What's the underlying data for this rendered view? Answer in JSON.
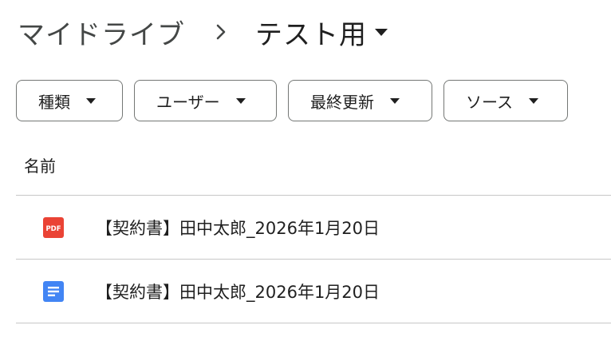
{
  "breadcrumb": {
    "root": "マイドライブ",
    "separator_icon": "chevron-right-icon",
    "current": "テスト用",
    "current_caret_icon": "caret-down-icon"
  },
  "filters": [
    {
      "label": "種類",
      "icon": "caret-down-icon"
    },
    {
      "label": "ユーザー",
      "icon": "caret-down-icon"
    },
    {
      "label": "最終更新",
      "icon": "caret-down-icon"
    },
    {
      "label": "ソース",
      "icon": "caret-down-icon"
    }
  ],
  "list": {
    "column_header": "名前",
    "files": [
      {
        "name": "【契約書】田中太郎_2026年1月20日",
        "icon": "pdf-file-icon",
        "icon_color": "#ea4335"
      },
      {
        "name": "【契約書】田中太郎_2026年1月20日",
        "icon": "google-docs-icon",
        "icon_color": "#4285f4"
      }
    ]
  },
  "colors": {
    "text": "#1f1f1f",
    "muted_text": "#444746",
    "chip_border": "#747775",
    "divider": "#c7c7c7"
  }
}
